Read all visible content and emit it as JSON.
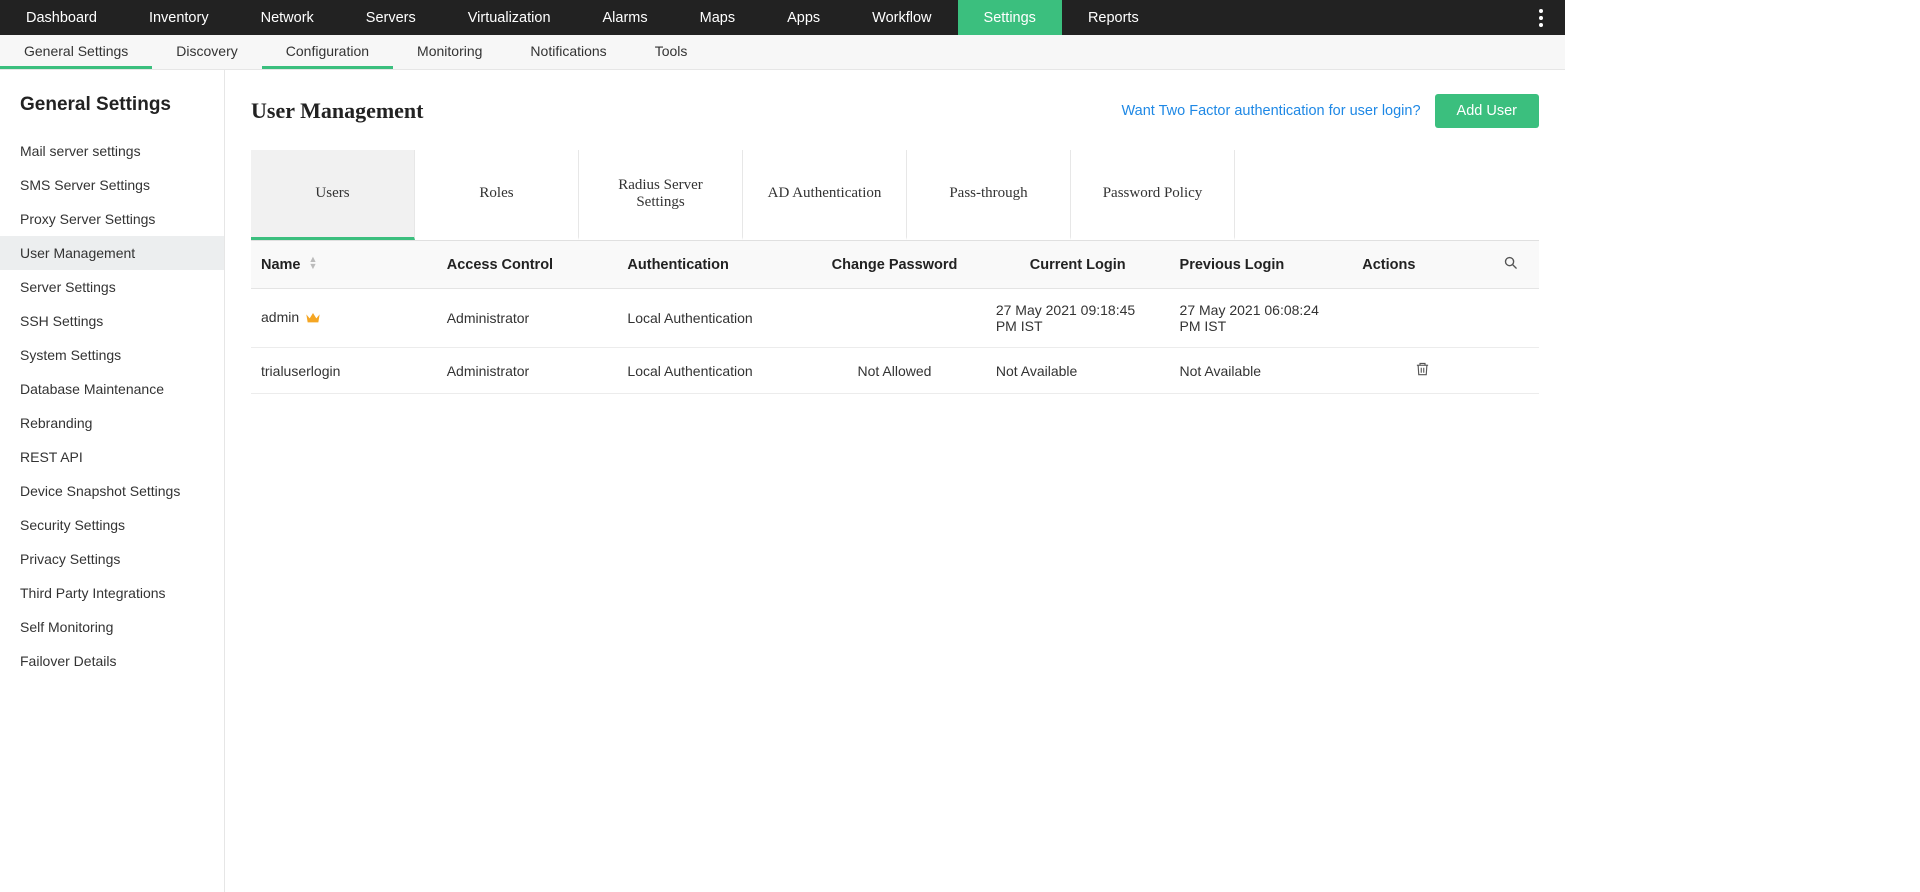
{
  "colors": {
    "accent": "#3bbf7e",
    "link": "#1e88e5"
  },
  "topnav": {
    "items": [
      {
        "label": "Dashboard"
      },
      {
        "label": "Inventory"
      },
      {
        "label": "Network"
      },
      {
        "label": "Servers"
      },
      {
        "label": "Virtualization"
      },
      {
        "label": "Alarms"
      },
      {
        "label": "Maps"
      },
      {
        "label": "Apps"
      },
      {
        "label": "Workflow"
      },
      {
        "label": "Settings",
        "active": true
      },
      {
        "label": "Reports"
      }
    ]
  },
  "subnav": {
    "items": [
      {
        "label": "General Settings",
        "active": true
      },
      {
        "label": "Discovery"
      },
      {
        "label": "Configuration",
        "active": true
      },
      {
        "label": "Monitoring"
      },
      {
        "label": "Notifications"
      },
      {
        "label": "Tools"
      }
    ]
  },
  "sidebar": {
    "title": "General Settings",
    "items": [
      {
        "label": "Mail server settings"
      },
      {
        "label": "SMS Server Settings"
      },
      {
        "label": "Proxy Server Settings"
      },
      {
        "label": "User Management",
        "active": true
      },
      {
        "label": "Server Settings"
      },
      {
        "label": "SSH Settings"
      },
      {
        "label": "System Settings"
      },
      {
        "label": "Database Maintenance"
      },
      {
        "label": "Rebranding"
      },
      {
        "label": "REST API"
      },
      {
        "label": "Device Snapshot Settings"
      },
      {
        "label": "Security Settings"
      },
      {
        "label": "Privacy Settings"
      },
      {
        "label": "Third Party Integrations"
      },
      {
        "label": "Self Monitoring"
      },
      {
        "label": "Failover Details"
      }
    ]
  },
  "page": {
    "title": "User Management",
    "twofa_link": "Want Two Factor authentication for user login?",
    "add_user_label": "Add User"
  },
  "tabs": {
    "items": [
      {
        "label": "Users",
        "active": true
      },
      {
        "label": "Roles"
      },
      {
        "label": "Radius Server Settings"
      },
      {
        "label": "AD Authentication"
      },
      {
        "label": "Pass-through"
      },
      {
        "label": "Password Policy"
      }
    ]
  },
  "table": {
    "columns": {
      "name": "Name",
      "access": "Access Control",
      "auth": "Authentication",
      "chpwd": "Change Password",
      "curr": "Current Login",
      "prev": "Previous Login",
      "actions": "Actions"
    },
    "rows": [
      {
        "name": "admin",
        "is_admin_crown": true,
        "access": "Administrator",
        "auth": "Local Authentication",
        "chpwd": "",
        "curr": "27 May 2021 09:18:45 PM IST",
        "prev": "27 May 2021 06:08:24 PM IST",
        "deletable": false
      },
      {
        "name": "trialuserlogin",
        "is_admin_crown": false,
        "access": "Administrator",
        "auth": "Local Authentication",
        "chpwd": "Not Allowed",
        "curr": "Not Available",
        "prev": "Not Available",
        "deletable": true
      }
    ]
  }
}
